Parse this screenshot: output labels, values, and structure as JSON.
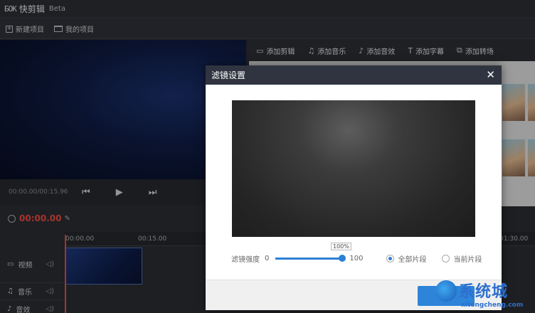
{
  "app": {
    "logo_mark": "ƂOK",
    "title": "快剪辑",
    "badge": "Beta"
  },
  "toolbar": {
    "new_project": "新建项目",
    "my_projects": "我的项目"
  },
  "player": {
    "time": "00:00.00/00:15.96",
    "prev_icon": "skip-back-icon",
    "play_icon": "play-icon",
    "next_icon": "skip-forward-icon"
  },
  "right_menu": [
    {
      "label": "添加剪辑",
      "icon": "video-camera-icon"
    },
    {
      "label": "添加音乐",
      "icon": "music-note-icon"
    },
    {
      "label": "添加音效",
      "icon": "sound-effect-icon"
    },
    {
      "label": "添加字幕",
      "icon": "text-icon"
    },
    {
      "label": "添加转场",
      "icon": "transition-icon"
    }
  ],
  "timeline": {
    "current_time": "00:00.00",
    "ruler_ticks": [
      "00:00.00",
      "00:15.00",
      "01:30.00"
    ],
    "tracks": [
      {
        "label": "视频"
      },
      {
        "label": "音乐"
      },
      {
        "label": "音效"
      }
    ]
  },
  "dialog": {
    "title": "滤镜设置",
    "strength_label": "滤镜强度",
    "min": "0",
    "max": "100",
    "tooltip": "100%",
    "strength_value": 100,
    "apply_all": "全部片段",
    "apply_current": "当前片段",
    "selected": "全部片段"
  },
  "watermark": {
    "text": "系统城",
    "url": "xitongcheng.com"
  },
  "colors": {
    "accent": "#2d84d8",
    "time_red": "#e8493f",
    "dialog_header": "#2f3440"
  }
}
